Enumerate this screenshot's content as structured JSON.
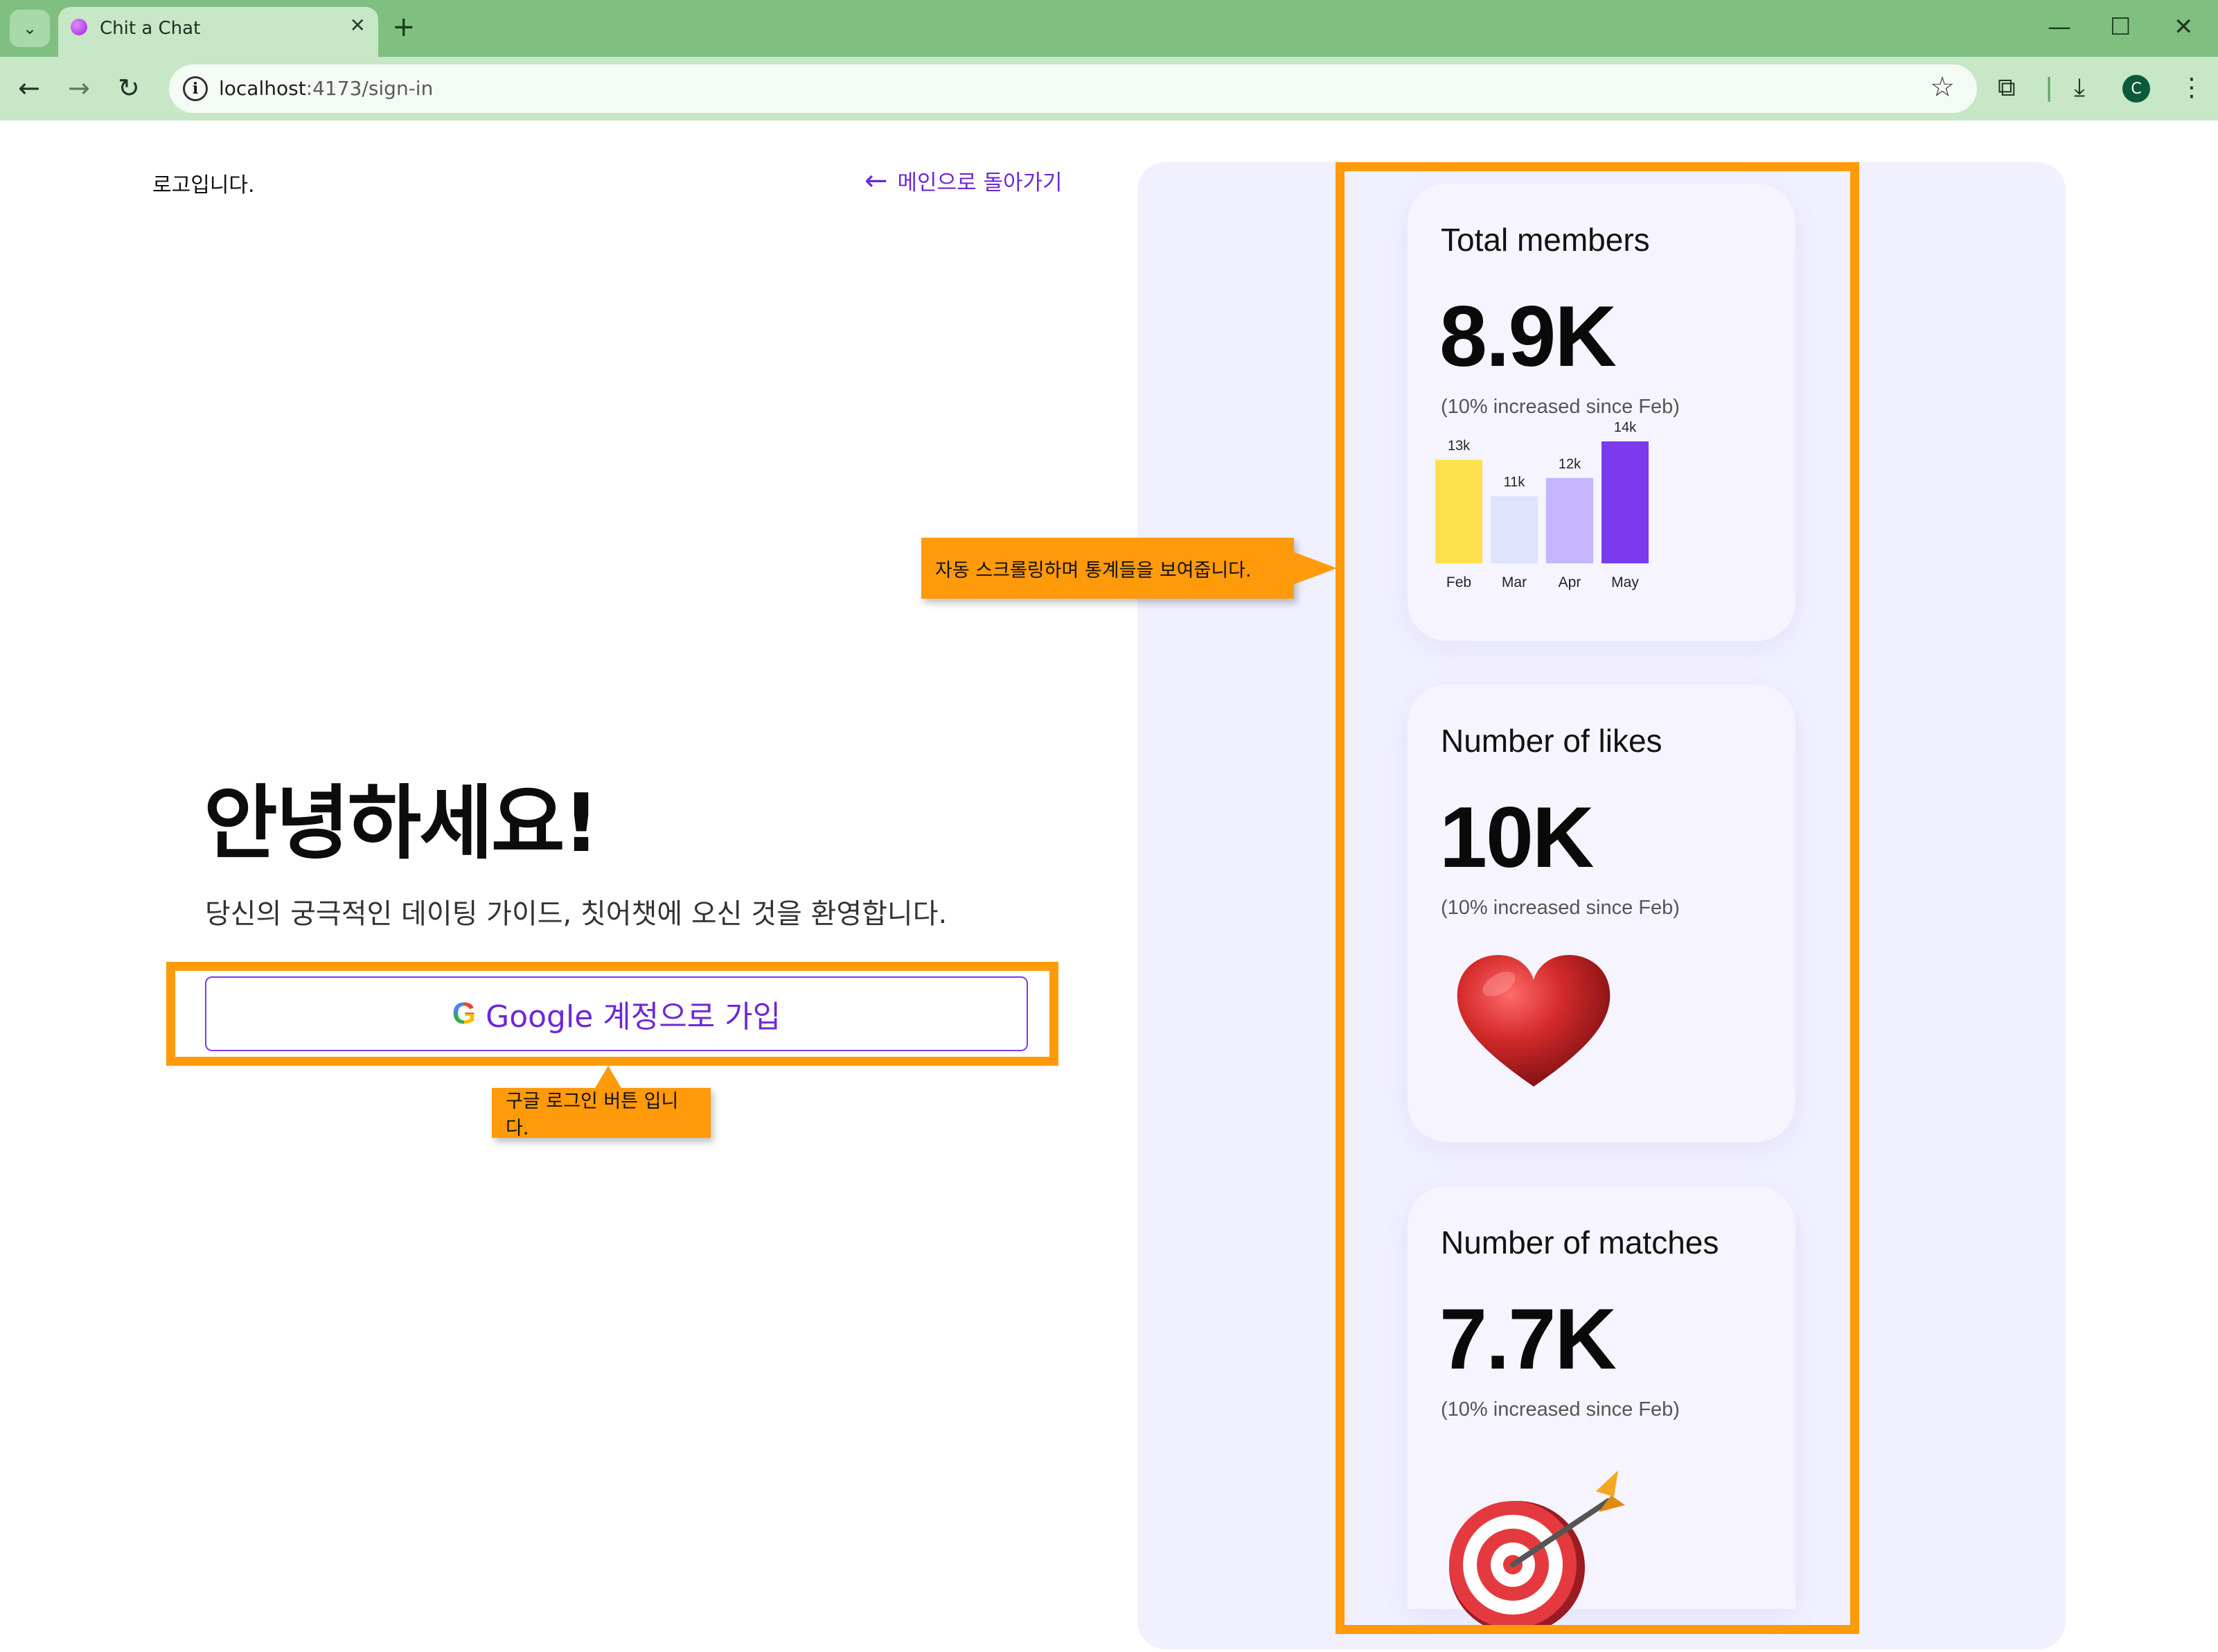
{
  "browser": {
    "tab_title": "Chit a Chat",
    "new_tab": "+",
    "tab_close": "✕",
    "url_host": "localhost",
    "url_path": ":4173/sign-in",
    "avatar_letter": "C"
  },
  "page": {
    "logo_text": "로고입니다.",
    "back_link": "메인으로 돌아가기",
    "hero_title": "안녕하세요!",
    "hero_subtitle": "당신의 궁극적인 데이팅 가이드, 칫어챗에 오신 것을 환영합니다.",
    "google_button": "Google 계정으로 가입",
    "google_logo": "G"
  },
  "annotations": {
    "stats_note": "자동 스크롤링하며 통계들을 보여줍니다.",
    "button_note": "구글 로그인 버튼 입니다."
  },
  "cards": [
    {
      "title": "Total members",
      "value": "8.9K",
      "note": "(10% increased since Feb)"
    },
    {
      "title": "Number of likes",
      "value": "10K",
      "note": "(10% increased since Feb)",
      "icon": "heart-icon"
    },
    {
      "title": "Number of matches",
      "value": "7.7K",
      "note": "(10% increased since Feb)",
      "icon": "target-icon"
    }
  ],
  "chart_data": {
    "type": "bar",
    "categories": [
      "Feb",
      "Mar",
      "Apr",
      "May"
    ],
    "values": [
      13,
      11,
      12,
      14
    ],
    "labels": [
      "13k",
      "11k",
      "12k",
      "14k"
    ],
    "colors": [
      "#ffe14d",
      "#dfe3fb",
      "#c4b5fd",
      "#7c3aed"
    ]
  },
  "colors": {
    "accent": "#6d28d9",
    "annotation": "#ff9a0a",
    "panel": "#f1f0ff"
  }
}
